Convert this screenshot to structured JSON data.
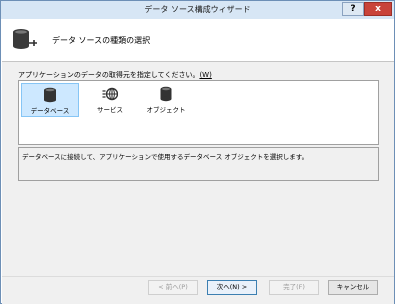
{
  "window": {
    "title": "データ ソース構成ウィザード"
  },
  "titlebar_buttons": {
    "help": "?",
    "close": "x"
  },
  "header": {
    "title": "データ ソースの種類の選択",
    "icon": "database-connect-icon"
  },
  "prompt": {
    "text": "アプリケーションのデータの取得元を指定してください。",
    "mnemonic": "(W)"
  },
  "listview": {
    "items": [
      {
        "label": "データベース",
        "icon": "database-icon",
        "selected": true
      },
      {
        "label": "サービス",
        "icon": "service-icon",
        "selected": false
      },
      {
        "label": "オブジェクト",
        "icon": "object-icon",
        "selected": false
      }
    ]
  },
  "description": "データベースに接続して、アプリケーションで使用するデータベース オブジェクトを選択します。",
  "buttons": {
    "previous": "< 前へ(P)",
    "next": "次へ(N) >",
    "finish": "完了(F)",
    "cancel": "キャンセル"
  },
  "colors": {
    "title_bar": "#d7e6f5",
    "close_button": "#c9433a",
    "selection": "#cde8ff"
  }
}
